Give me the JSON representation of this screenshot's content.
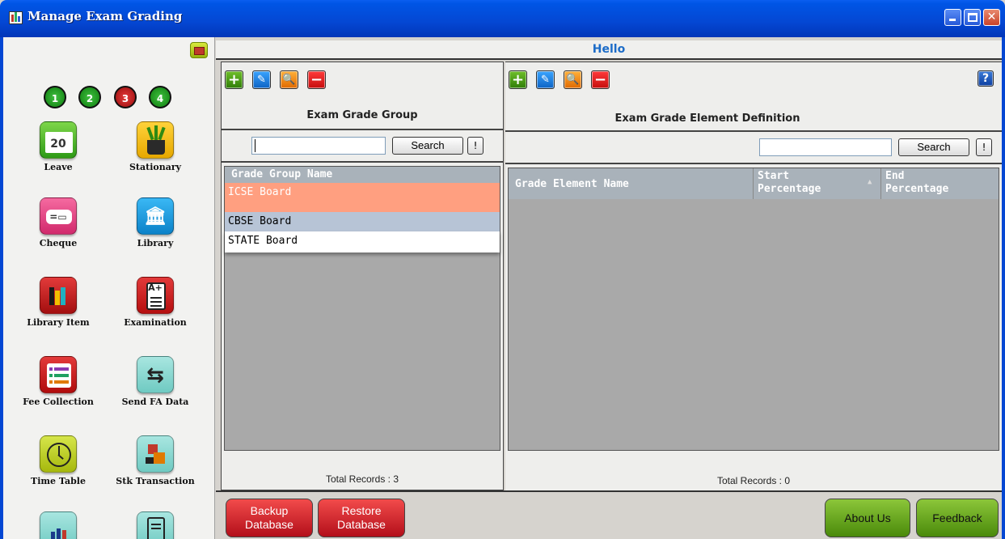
{
  "window": {
    "title": "Manage Exam Grading"
  },
  "sidebar": {
    "steps": [
      "1",
      "2",
      "3",
      "4"
    ],
    "tiles": [
      {
        "label": "Leave",
        "icon": "calendar-icon",
        "glyph": "20"
      },
      {
        "label": "Stationary",
        "icon": "plant-pot-icon",
        "glyph": ""
      },
      {
        "label": "Cheque",
        "icon": "cheque-icon",
        "glyph": "=▭"
      },
      {
        "label": "Library",
        "icon": "library-building-icon",
        "glyph": "🏛"
      },
      {
        "label": "Library Item",
        "icon": "books-icon",
        "glyph": ""
      },
      {
        "label": "Examination",
        "icon": "exam-sheet-icon",
        "glyph": "A+"
      },
      {
        "label": "Fee Collection",
        "icon": "list-icon",
        "glyph": "☰"
      },
      {
        "label": "Send FA Data",
        "icon": "transfer-arrows-icon",
        "glyph": "⇆"
      },
      {
        "label": "Time Table",
        "icon": "clock-icon",
        "glyph": "◷"
      },
      {
        "label": "Stk Transaction",
        "icon": "stock-transfer-icon",
        "glyph": ""
      }
    ]
  },
  "header": {
    "greeting": "Hello"
  },
  "left_panel": {
    "title": "Exam Grade Group",
    "search_value": "",
    "search_label": "Search",
    "bang_label": "!",
    "column": "Grade Group Name",
    "rows": [
      "ICSE Board",
      "CBSE Board",
      "STATE Board"
    ],
    "total": "Total Records : 3"
  },
  "right_panel": {
    "title": "Exam Grade Element Definition",
    "search_value": "",
    "search_label": "Search",
    "bang_label": "!",
    "help_label": "?",
    "columns": {
      "name": "Grade Element Name",
      "start_1": "Start",
      "start_2": "Percentage",
      "end_1": "End",
      "end_2": "Percentage"
    },
    "total": "Total Records : 0"
  },
  "footer": {
    "backup_1": "Backup",
    "backup_2": "Database",
    "restore_1": "Restore",
    "restore_2": "Database",
    "about": "About Us",
    "feedback": "Feedback"
  },
  "colors": {
    "selected_row": "#ff9f80",
    "hover_row": "#b7c4d6",
    "title_bar": "#0447d3",
    "greeting": "#1c6cc8"
  }
}
